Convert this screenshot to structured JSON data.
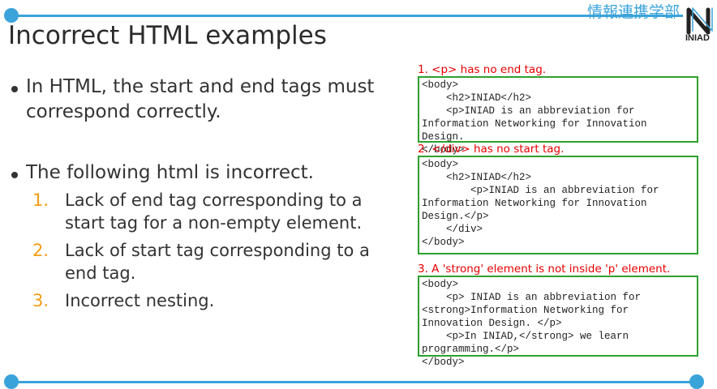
{
  "header": {
    "department": "情報連携学部",
    "logo_text": "INIAD"
  },
  "slide": {
    "title": "Incorrect HTML examples",
    "bullet1": "In HTML, the start and end tags must correspond correctly.",
    "bullet2": "The following html is incorrect.",
    "items": [
      {
        "num": "1.",
        "text": "Lack of end tag corresponding to a start tag for a non-empty element."
      },
      {
        "num": "2.",
        "text": "Lack of start tag corresponding to a end tag."
      },
      {
        "num": "3.",
        "text": "Incorrect nesting."
      }
    ]
  },
  "examples": [
    {
      "caption": "1. <p> has no end tag.",
      "code": "<body>\n    <h2>INIAD</h2>\n    <p>INIAD is an abbreviation for\nInformation Networking for Innovation\nDesign.\n</body>"
    },
    {
      "caption": "2. </div> has no start tag.",
      "code": "<body>\n    <h2>INIAD</h2>\n        <p>INIAD is an abbreviation for\nInformation Networking for Innovation\nDesign.</p>\n    </div>\n</body>"
    },
    {
      "caption": "3. A 'strong' element is not inside 'p' element.",
      "code": "<body>\n    <p> INIAD is an abbreviation for\n<strong>Information Networking for\nInnovation Design. </p>\n    <p>In INIAD,</strong> we learn\nprogramming.</p>\n</body>"
    }
  ],
  "colors": {
    "accent": "#3aa3da",
    "number": "#f39c12",
    "caption_red": "#e60000",
    "code_border": "#2ea02e"
  }
}
